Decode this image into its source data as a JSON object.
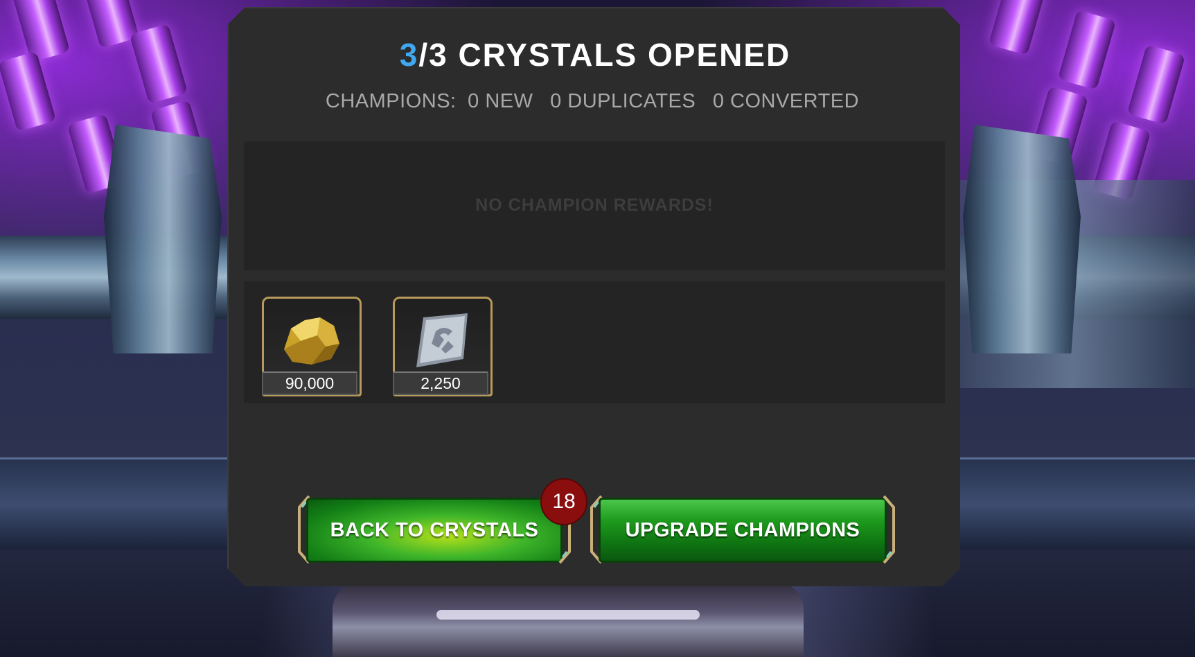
{
  "header": {
    "opened_count": "3",
    "title_rest": "/3 CRYSTALS OPENED"
  },
  "summary": {
    "label": "CHAMPIONS:",
    "new_count": "0",
    "new_label": "NEW",
    "duplicates_count": "0",
    "duplicates_label": "DUPLICATES",
    "converted_count": "0",
    "converted_label": "CONVERTED"
  },
  "champion_rewards": {
    "empty_message": "NO CHAMPION REWARDS!"
  },
  "rewards": [
    {
      "icon": "gold-icon",
      "quantity": "90,000"
    },
    {
      "icon": "iso-8-icon",
      "quantity": "2,250"
    }
  ],
  "buttons": {
    "back_label": "BACK TO CRYSTALS",
    "back_badge": "18",
    "upgrade_label": "UPGRADE CHAMPIONS"
  },
  "colors": {
    "accent": "#3fa8f0",
    "button_green": "#1d9a1d",
    "badge_red": "#8b0e0e",
    "frame_gold": "#b89a5a"
  }
}
